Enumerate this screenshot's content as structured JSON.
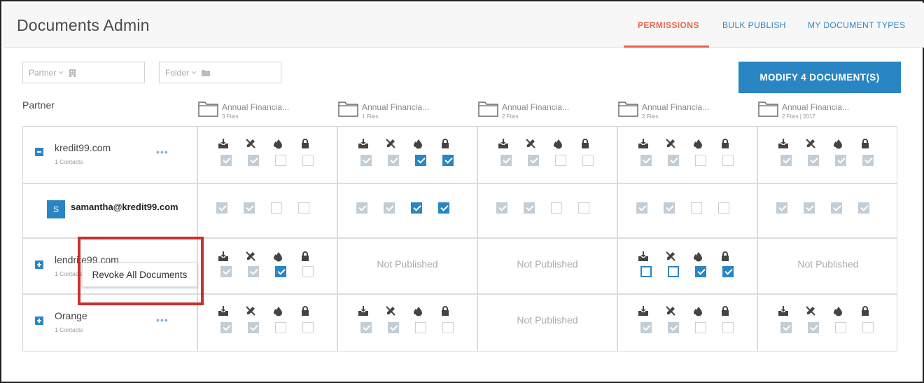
{
  "app": {
    "title": "Documents Admin"
  },
  "nav": {
    "tabs": [
      {
        "label": "PERMISSIONS",
        "active": true
      },
      {
        "label": "BULK PUBLISH",
        "active": false
      },
      {
        "label": "MY DOCUMENT TYPES",
        "active": false
      }
    ]
  },
  "filters": {
    "partner": {
      "label": "Partner",
      "icon": "building-icon"
    },
    "folder": {
      "label": "Folder",
      "icon": "folder-icon"
    }
  },
  "actions": {
    "modify_label": "MODIFY 4 DOCUMENT(S)"
  },
  "colors": {
    "accent": "#2a86c3",
    "active_tab": "#e8644a",
    "highlight": "#c9302c"
  },
  "table": {
    "partner_header": "Partner",
    "columns": [
      {
        "name": "Annual Financia...",
        "meta": "3 Files"
      },
      {
        "name": "Annual Financia...",
        "meta": "1 Files"
      },
      {
        "name": "Annual Financia...",
        "meta": "2 Files"
      },
      {
        "name": "Annual Financia...",
        "meta": "2 Files"
      },
      {
        "name": "Annual Financia...",
        "meta": "2 Files | 2017"
      }
    ],
    "permission_icons": [
      "download-icon",
      "edit-off-icon",
      "watermark-icon",
      "lock-icon"
    ],
    "not_published": "Not Published",
    "rows": [
      {
        "name": "kredit99.com",
        "contacts": "1 Contacts",
        "expanded": true
      },
      {
        "email": "samantha@kredit99.com",
        "avatar": "S"
      },
      {
        "name": "lendrite99.com",
        "contacts": "1 Contacts",
        "expanded": false
      },
      {
        "name": "Orange",
        "contacts": "1 Contacts",
        "expanded": false
      }
    ]
  },
  "context_menu": {
    "revoke_label": "Revoke All Documents"
  }
}
